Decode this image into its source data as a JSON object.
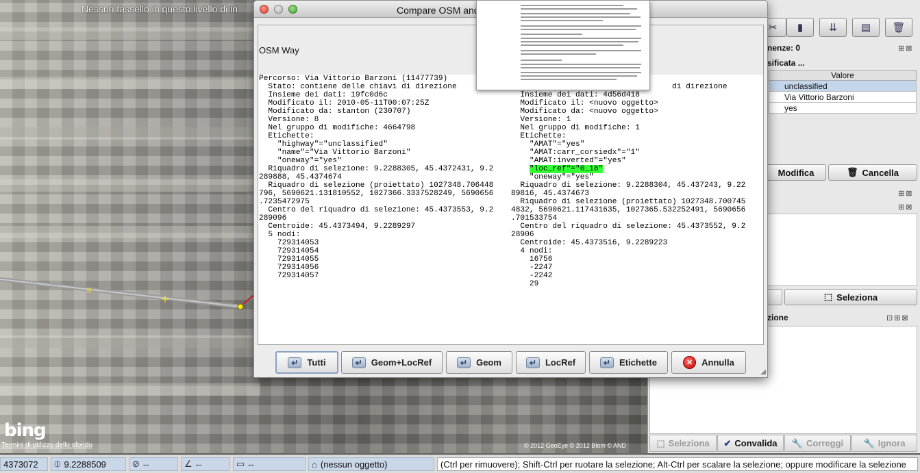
{
  "map": {
    "notice": "Nessun tassello in questo livello di in",
    "bing_logo": "bing",
    "bing_terms": "Termini di utilizzo dello sfondo",
    "copyright": "© 2012 GeoEye © 2012 Blom © AND"
  },
  "dialog": {
    "title": "Compare OSM and",
    "osm_way_label": "OSM Way",
    "left_lines": [
      "Percorso: Via Vittorio Barzoni (11477739)",
      "  Stato: contiene delle chiavi di direzione",
      "  Insieme dei dati: 19fc0d6c",
      "  Modificato il: 2010-05-11T00:07:25Z",
      "  Modificato da: stanton (230707)",
      "  Versione: 8",
      "  Nel gruppo di modifiche: 4664798",
      "  Etichette:",
      "    \"highway\"=\"unclassified\"",
      "    \"name\"=\"Via Vittorio Barzoni\"",
      "    \"oneway\"=\"yes\"",
      "  Riquadro di selezione: 9.2288305, 45.4372431, 9.2",
      "289888, 45.4374674",
      "  Riquadro di selezione (proiettato) 1027348.706448",
      "796, 5690621.131810552, 1027366.3337528249, 5690656",
      ".7235472975",
      "  Centro del riquadro di selezione: 45.4373553, 9.2",
      "289096",
      "  Centroide: 45.4373494, 9.2289297",
      "  5 nodi:",
      "    729314053",
      "    729314054",
      "    729314055",
      "    729314056",
      "    729314057"
    ],
    "right_lines": [
      "",
      "                                   di direzione",
      "  Insieme dei dati: 4d56d418",
      "  Modificato il: <nuovo oggetto>",
      "  Modificato da: <nuovo oggetto>",
      "  Versione: 1",
      "  Nel gruppo di modifiche: 1",
      "  Etichette:",
      "    \"AMAT\"=\"yes\"",
      "    \"AMAT:carr_corsiedx\"=\"1\"",
      "    \"AMAT:inverted\"=\"yes\"",
      "    \"loc_ref\"=\"0_18\"",
      "    \"oneway\"=\"yes\"",
      "  Riquadro di selezione: 9.2288304, 45.437243, 9.22",
      "89816, 45.4374673",
      "  Riquadro di selezione (proiettato) 1027348.700745",
      "4832, 5690621.117431635, 1027365.532252491, 5690656",
      ".701533754",
      "  Centro del riquadro di selezione: 45.4373552, 9.2",
      "28906",
      "  Centroide: 45.4373516, 9.2289223",
      "  4 nodi:",
      "    16756",
      "    -2247",
      "    -2242",
      "    29"
    ],
    "highlight_color": "#33ff33",
    "buttons": {
      "tutti": "Tutti",
      "geom_locref": "Geom+LocRef",
      "geom": "Geom",
      "locref": "LocRef",
      "etichette": "Etichette",
      "annulla": "Annulla"
    }
  },
  "side": {
    "relations_title": "nenze: 0",
    "tags_title": "sificata ...",
    "value_header": "Valore",
    "tag_values": [
      "unclassified",
      "Via Vittorio Barzoni",
      "yes"
    ],
    "modifica": "Modifica",
    "cancella": "Cancella",
    "seleziona": "Seleziona",
    "bottom_title": "zione",
    "validator": {
      "seleziona": "Seleziona",
      "convalida": "Convalida",
      "correggi": "Correggi",
      "ignora": "Ignora"
    }
  },
  "status": {
    "lat": "4373072",
    "lon": "9.2288509",
    "heading": "--",
    "angle": "--",
    "length": "--",
    "object": "(nessun oggetto)",
    "help": "(Ctrl per rimuovere); Shift-Ctrl per ruotare la selezione; Alt-Ctrl per scalare la selezione; oppure modificare la selezione"
  }
}
